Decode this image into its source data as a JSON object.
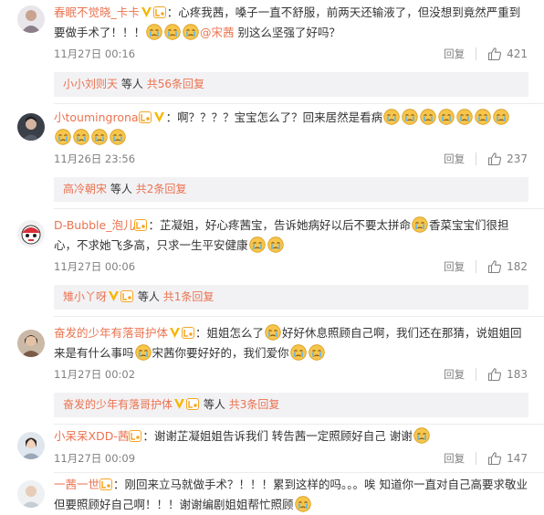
{
  "comments": [
    {
      "username": "春眠不觉晓_卡卡",
      "text_a": "：心疼我茜，嗓子一直不舒服，前两天还输液了，但没想到竟然严重到要做手术了！！！",
      "mention": "@宋茜",
      "text_b": " 别这么坚强了好吗？",
      "time": "11月27日 00:16",
      "reply": "回复",
      "likes": "421",
      "sub_user": "小小刘则天",
      "sub_mid": "等人",
      "sub_count": "共56条回复"
    },
    {
      "username": "小toumingrona",
      "text_a": "：啊？？？？宝宝怎么了？回来居然是看病",
      "time": "11月26日 23:56",
      "reply": "回复",
      "likes": "237",
      "sub_user": "高冷朝宋",
      "sub_mid": "等人",
      "sub_count": "共2条回复"
    },
    {
      "username": "D-Bubble_泡儿",
      "text_a": "：芷凝姐，好心疼茜宝，告诉她病好以后不要太拼命",
      "text_b": "香菜宝宝们很担心，不求她飞多高，只求一生平安健康",
      "time": "11月27日 00:06",
      "reply": "回复",
      "likes": "182",
      "sub_user": "雉小丫呀",
      "sub_mid": "等人",
      "sub_count": "共1条回复"
    },
    {
      "username": "奋发的少年有落哥护体",
      "text_a": "：姐姐怎么了",
      "text_b": "好好休息照顾自己啊，我们还在那猜，说姐姐回来是有什么事吗",
      "text_c": "宋茜你要好好的，我们爱你",
      "time": "11月27日 00:02",
      "reply": "回复",
      "likes": "183",
      "sub_user": "奋发的少年有落哥护体",
      "sub_mid": "等人",
      "sub_count": "共3条回复"
    },
    {
      "username": "小呆呆XDD-茜",
      "text_a": "：谢谢芷凝姐姐告诉我们 转告茜一定照顾好自己 谢谢",
      "time": "11月27日 00:09",
      "reply": "回复",
      "likes": "147"
    },
    {
      "username": "一茜一世",
      "text_a": "：刚回来立马就做手术？！！！累到这样的吗。。。唉 知道你一直对自己高要求敬业 但要照顾好自己啊！！！谢谢编剧姐姐帮忙照顾"
    }
  ],
  "colors": {
    "accent": "#eb7350",
    "meta": "#808080",
    "subbg": "#f2f2f5",
    "vbadge": "#f7b500"
  },
  "icons": {
    "like": "thumbs-up-icon",
    "verified": "verified-v-icon",
    "level": "member-level-icon",
    "emoji": "crying-emoji-icon"
  }
}
